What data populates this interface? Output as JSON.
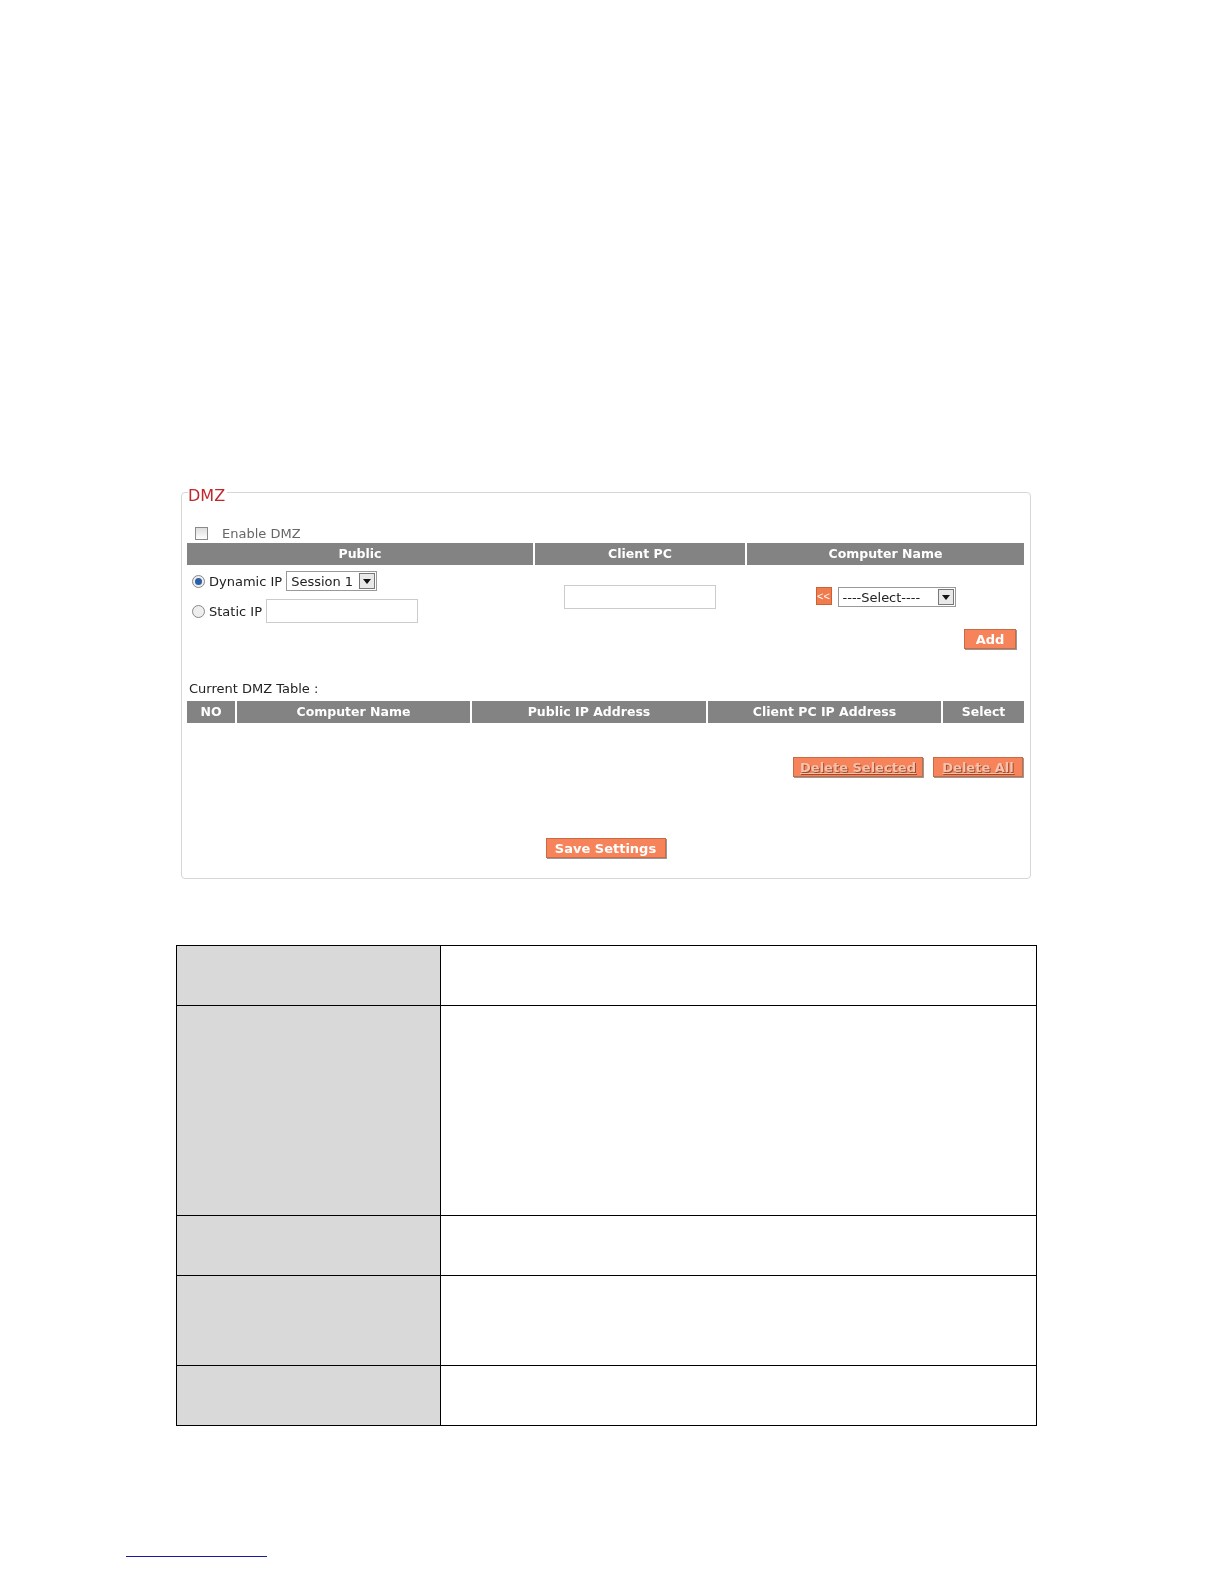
{
  "panel": {
    "title": "DMZ",
    "enable": {
      "label": "Enable  DMZ",
      "checked": false
    },
    "columns": [
      "Public",
      "Client PC",
      "Computer Name"
    ],
    "public_options": [
      {
        "kind": "select",
        "label": "Dynamic IP",
        "selected": true,
        "value": "Session  1"
      },
      {
        "kind": "field",
        "label": "Static IP",
        "selected": false
      }
    ],
    "copy_button": "<<",
    "computer_select": "----Select----",
    "add_button": {
      "label": "Add",
      "disabled": false
    },
    "table_title": "Current DMZ Table :",
    "table_columns": [
      "NO",
      "Computer Name",
      "Public  IP Address",
      "Client PC  IP Address",
      "Select"
    ],
    "table_buttons": [
      {
        "label": "Delete Selected",
        "disabled": true
      },
      {
        "label": "Delete All",
        "disabled": true
      }
    ],
    "save_button": {
      "label": "Save Settings",
      "disabled": false
    }
  }
}
